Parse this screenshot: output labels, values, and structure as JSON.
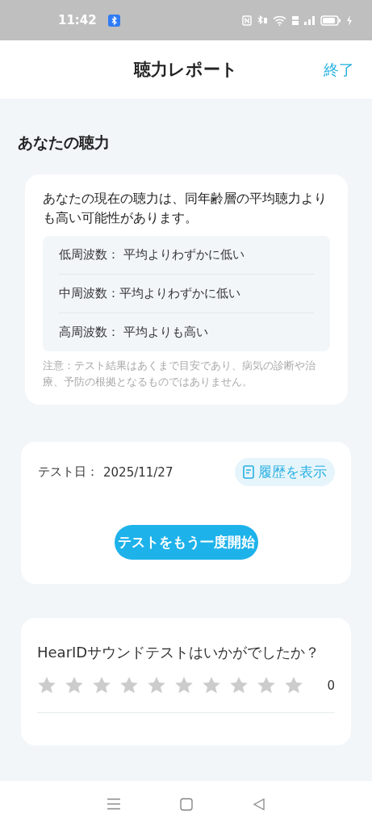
{
  "status_bar": {
    "time": "11:42"
  },
  "header": {
    "title": "聴力レポート",
    "done": "終了"
  },
  "section_title": "あなたの聴力",
  "result_card": {
    "summary": "あなたの現在の聴力は、同年齢層の平均聴力よりも高い可能性があります。",
    "frequencies": [
      {
        "text": "低周波数： 平均よりわずかに低い"
      },
      {
        "text": "中周波数：平均よりわずかに低い"
      },
      {
        "text": "高周波数： 平均よりも高い"
      }
    ],
    "note": "注意：テスト結果はあくまで目安であり、病気の診断や治療、予防の根拠となるものではありません。"
  },
  "test_card": {
    "date_label": "テスト日：",
    "date": "2025/11/27",
    "history_button": "履歴を表示",
    "restart_button": "テストをもう一度開始"
  },
  "rating_card": {
    "question": "HearIDサウンドテストはいかがでしたか？",
    "stars": 0,
    "count": "0"
  }
}
